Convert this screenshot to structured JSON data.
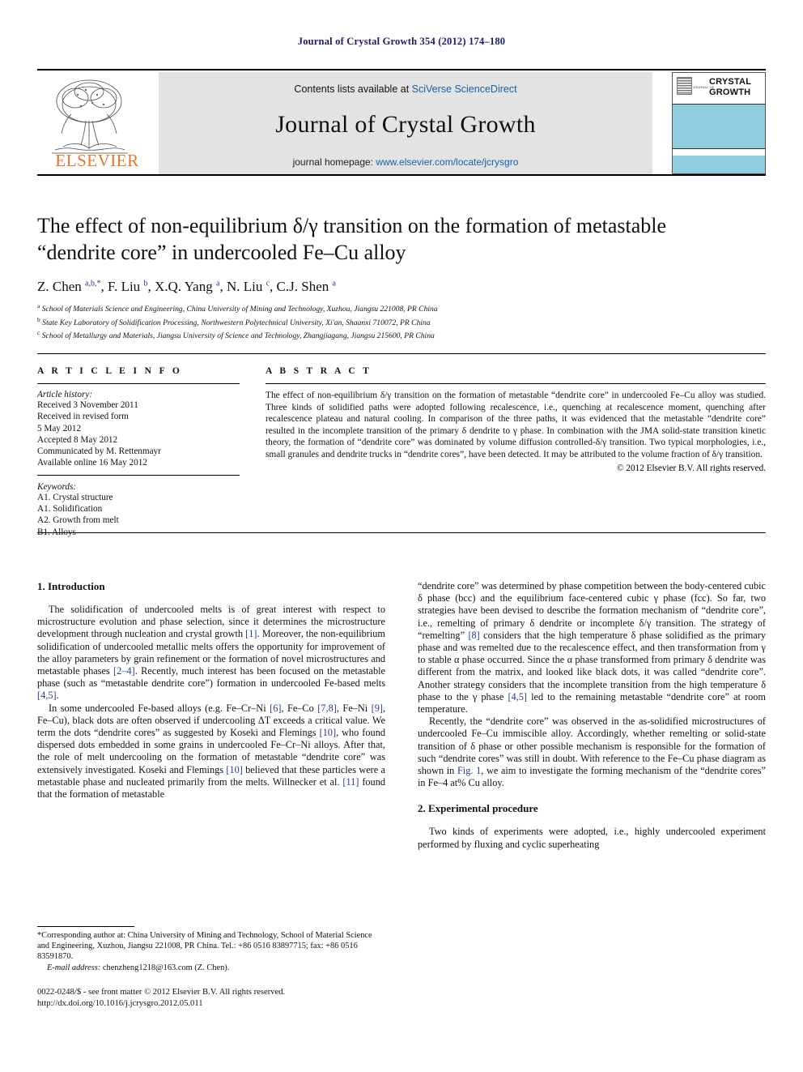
{
  "running_head": "Journal of Crystal Growth 354 (2012) 174–180",
  "masthead": {
    "contents_prefix": "Contents lists available at ",
    "contents_link": "SciVerse ScienceDirect",
    "journal_name": "Journal of Crystal Growth",
    "homepage_prefix": "journal homepage: ",
    "homepage_url": "www.elsevier.com/locate/jcrysgro",
    "publisher_wordmark": "ELSEVIER",
    "cover": {
      "journal_of": "JOURNAL OF",
      "line1": "CRYSTAL",
      "line2": "GROWTH",
      "band_color": "#8ecedf"
    }
  },
  "article": {
    "title": "The effect of non-equilibrium δ/γ transition on the formation of metastable “dendrite core” in undercooled Fe–Cu alloy",
    "authors_html": "Z. Chen <sup>a,b,</sup><sup>*</sup>, F. Liu <sup>b</sup>, X.Q. Yang <sup>a</sup>, N. Liu <sup>c</sup>, C.J. Shen <sup>a</sup>",
    "affiliations": [
      {
        "marker": "a",
        "text": "School of Materials Science and Engineering, China University of Mining and Technology, Xuzhou, Jiangsu 221008, PR China"
      },
      {
        "marker": "b",
        "text": "State Key Laboratory of Solidification Processing, Northwestern Polytechnical University, Xi'an, Shaanxi 710072, PR China"
      },
      {
        "marker": "c",
        "text": "School of Metallurgy and Materials, Jiangsu University of Science and Technology, Zhangjiagang, Jiangsu 215600, PR China"
      }
    ]
  },
  "article_info": {
    "heading": "A R T I C L E   I N F O",
    "history_label": "Article history:",
    "history": [
      "Received 3 November 2011",
      "Received in revised form",
      "5 May 2012",
      "Accepted 8 May 2012",
      "Communicated by M. Rettenmayr",
      "Available online 16 May 2012"
    ],
    "keywords_label": "Keywords:",
    "keywords": [
      "A1. Crystal structure",
      "A1. Solidification",
      "A2. Growth from melt",
      "B1. Alloys"
    ]
  },
  "abstract": {
    "heading": "A B S T R A C T",
    "text": "The effect of non-equilibrium δ/γ transition on the formation of metastable “dendrite core” in undercooled Fe–Cu alloy was studied. Three kinds of solidified paths were adopted following recalescence, i.e., quenching at recalescence moment, quenching after recalescence plateau and natural cooling. In comparison of the three paths, it was evidenced that the metastable “dendrite core” resulted in the incomplete transition of the primary δ dendrite to γ phase. In combination with the JMA solid-state transition kinetic theory, the formation of “dendrite core” was dominated by volume diffusion controlled-δ/γ transition. Two typical morphologies, i.e., small granules and dendrite trucks in “dendrite cores”, have been detected. It may be attributed to the volume fraction of δ/γ transition.",
    "copyright": "© 2012 Elsevier B.V. All rights reserved."
  },
  "sections": {
    "introduction_heading": "1. Introduction",
    "experimental_heading": "2. Experimental procedure"
  },
  "body": {
    "left": [
      "The solidification of undercooled melts is of great interest with respect to microstructure evolution and phase selection, since it determines the microstructure development through nucleation and crystal growth [1]. Moreover, the non-equilibrium solidification of undercooled metallic melts offers the opportunity for improvement of the alloy parameters by grain refinement or the formation of novel microstructures and metastable phases [2–4]. Recently, much interest has been focused on the metastable phase (such as “metastable dendrite core”) formation in undercooled Fe-based melts [4,5].",
      "In some undercooled Fe-based alloys (e.g. Fe–Cr–Ni [6], Fe–Co [7,8], Fe–Ni [9], Fe–Cu), black dots are often observed if undercooling ΔT exceeds a critical value. We term the dots “dendrite cores” as suggested by Koseki and Flemings [10], who found dispersed dots embedded in some grains in undercooled Fe–Cr–Ni alloys. After that, the role of melt undercooling on the formation of metastable “dendrite core” was extensively investigated. Koseki and Flemings [10] believed that these particles were a metastable phase and nucleated primarily from the melts. Willnecker et al. [11] found that the formation of metastable"
    ],
    "right": [
      "“dendrite core” was determined by phase competition between the body-centered cubic δ phase (bcc) and the equilibrium face-centered cubic γ phase (fcc). So far, two strategies have been devised to describe the formation mechanism of “dendrite core”, i.e., remelting of primary δ dendrite or incomplete δ/γ transition. The strategy of “remelting” [8] considers that the high temperature δ phase solidified as the primary phase and was remelted due to the recalescence effect, and then transformation from γ to stable α phase occurred. Since the α phase transformed from primary δ dendrite was different from the matrix, and looked like black dots, it was called “dendrite core”. Another strategy considers that the incomplete transition from the high temperature δ phase to the γ phase [4,5] led to the remaining metastable “dendrite core” at room temperature.",
      "Recently, the “dendrite core” was observed in the as-solidified microstructures of undercooled Fe–Cu immiscible alloy. Accordingly, whether remelting or solid-state transition of δ phase or other possible mechanism is responsible for the formation of such “dendrite cores” was still in doubt. With reference to the Fe–Cu phase diagram as shown in Fig. 1, we aim to investigate the forming mechanism of the “dendrite cores” in Fe–4 at% Cu alloy."
    ],
    "experimental_paragraph": "Two kinds of experiments were adopted, i.e., highly undercooled experiment performed by fluxing and cyclic superheating"
  },
  "footnote": {
    "corresponding": "*Corresponding author at: China University of Mining and Technology, School of Material Science and Engineering, Xuzhou, Jiangsu 221008, PR China. Tel.: +86 0516 83897715; fax: +86 0516 83591870.",
    "email_label": "E-mail address:",
    "email": "chenzheng1218@163.com (Z. Chen)."
  },
  "footer": {
    "issn_line": "0022-0248/$ - see front matter © 2012 Elsevier B.V. All rights reserved.",
    "doi": "http://dx.doi.org/10.1016/j.jcrysgro.2012.05.011"
  }
}
